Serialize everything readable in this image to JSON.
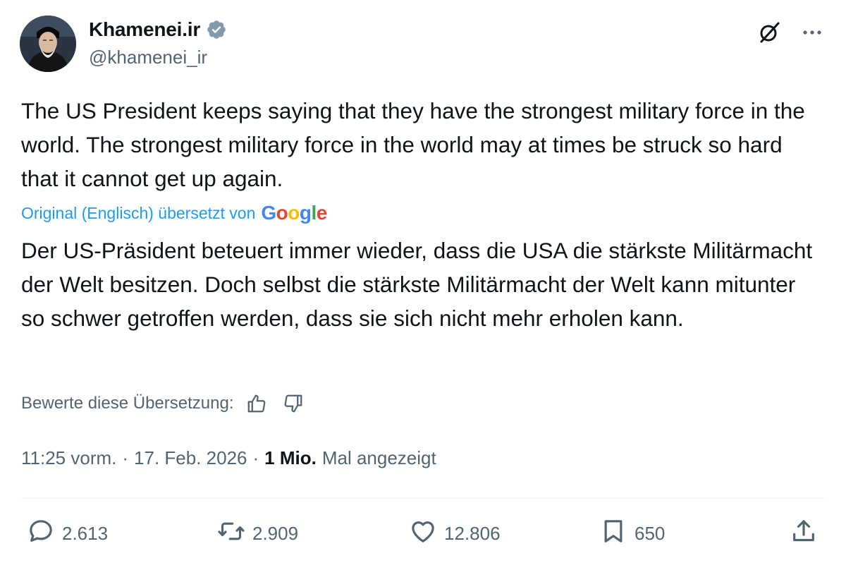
{
  "author": {
    "display_name": "Khamenei.ir",
    "handle": "@khamenei_ir",
    "verified_icon": "verified-badge-icon"
  },
  "tweet": {
    "original_text": "The US President keeps saying that they have the strongest military force in the world. The strongest military force in the world may at times be struck so hard that it cannot get up again.",
    "translation_label": "Original (Englisch) übersetzt von",
    "translation_provider": "Google",
    "translated_text": "Der US-Präsident beteuert immer wieder, dass die USA die stärkste Militärmacht der Welt besitzen. Doch selbst die stärkste Militärmacht der Welt kann mitunter so schwer getroffen werden, dass sie sich nicht mehr erholen kann.",
    "rate_label": "Bewerte diese Übersetzung:"
  },
  "meta": {
    "time": "11:25 vorm.",
    "date": "17. Feb. 2026",
    "views_count": "1 Mio.",
    "views_label": "Mal angezeigt",
    "separator": "·"
  },
  "actions": {
    "replies": "2.613",
    "reposts": "2.909",
    "likes": "12.806",
    "bookmarks": "650"
  },
  "colors": {
    "text_primary": "#0f1419",
    "text_secondary": "#536471",
    "link_blue": "#1d9bf0",
    "verified_gray": "#829aab"
  }
}
